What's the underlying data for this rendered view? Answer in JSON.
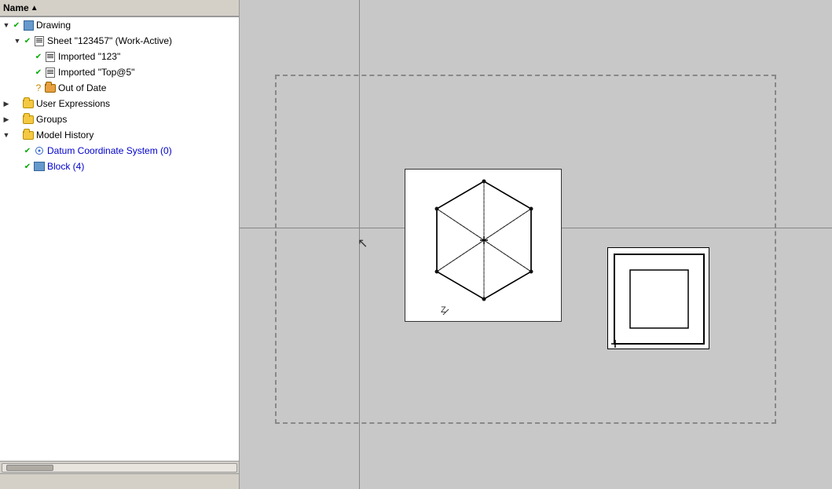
{
  "header": {
    "name_col": "Name",
    "sort_indicator": "▲"
  },
  "tree": {
    "items": [
      {
        "id": "drawing",
        "label": "Drawing",
        "indent": 0,
        "check": "✔",
        "check_type": "normal",
        "icon": "drawing",
        "expand": "▼"
      },
      {
        "id": "sheet",
        "label": "Sheet \"123457\" (Work-Active)",
        "indent": 1,
        "check": "✔",
        "check_type": "normal",
        "icon": "sheet",
        "expand": "▼"
      },
      {
        "id": "imported-123",
        "label": "Imported \"123\"",
        "indent": 2,
        "check": "✔",
        "check_type": "normal",
        "icon": "import",
        "expand": ""
      },
      {
        "id": "imported-top",
        "label": "Imported \"Top@5\"",
        "indent": 2,
        "check": "✔",
        "check_type": "normal",
        "icon": "import",
        "expand": ""
      },
      {
        "id": "out-of-date",
        "label": "Out of Date",
        "indent": 2,
        "check": "?",
        "check_type": "question",
        "icon": "folder-orange",
        "expand": ""
      },
      {
        "id": "user-expressions",
        "label": "User Expressions",
        "indent": 0,
        "check": "",
        "check_type": "none",
        "icon": "folder",
        "expand": "▶"
      },
      {
        "id": "groups",
        "label": "Groups",
        "indent": 0,
        "check": "",
        "check_type": "none",
        "icon": "folder",
        "expand": "▶"
      },
      {
        "id": "model-history",
        "label": "Model History",
        "indent": 0,
        "check": "",
        "check_type": "none",
        "icon": "folder",
        "expand": "▼"
      },
      {
        "id": "datum-coord",
        "label": "Datum Coordinate System (0)",
        "indent": 1,
        "check": "✔",
        "check_type": "normal",
        "icon": "datum",
        "expand": ""
      },
      {
        "id": "block",
        "label": "Block (4)",
        "indent": 1,
        "check": "✔",
        "check_type": "normal",
        "icon": "block",
        "expand": ""
      }
    ]
  },
  "canvas": {
    "background": "#c0bdb8"
  }
}
